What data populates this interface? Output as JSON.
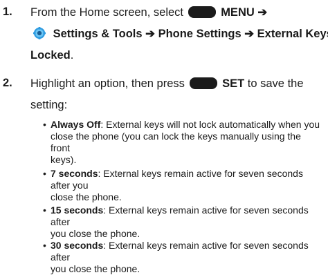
{
  "step1": {
    "num": "1.",
    "intro": "From the Home screen, select",
    "menu_label": "MENU",
    "arrow1": "➔",
    "settings": "Settings & Tools",
    "arrow2": "➔",
    "phone_settings": "Phone Settings",
    "arrow3": "➔",
    "ext_keys_1": "External Keys",
    "ext_keys_2": "Locked",
    "period": "."
  },
  "step2": {
    "num": "2.",
    "text_a": "Highlight an option, then press",
    "set_label": "SET",
    "text_b": "to save the",
    "text_c": "setting:"
  },
  "options": [
    {
      "label": "Always Off",
      "lines": [
        ": External keys will not lock automatically when you",
        "close the phone (you can lock the keys manually using the front",
        "keys)."
      ]
    },
    {
      "label": "7 seconds",
      "lines": [
        ": External keys remain active for seven seconds after you",
        "close the phone."
      ]
    },
    {
      "label": "15 seconds",
      "lines": [
        ": External keys remain active for seven seconds after",
        "you close the phone."
      ]
    },
    {
      "label": "30 seconds",
      "lines": [
        ": External keys remain active for seven seconds after",
        "you close the phone."
      ]
    }
  ],
  "bullet_char": "•",
  "icons": {
    "menu_key": "rounded-key-icon",
    "settings": "gear-icon",
    "set_key": "rounded-key-icon"
  }
}
